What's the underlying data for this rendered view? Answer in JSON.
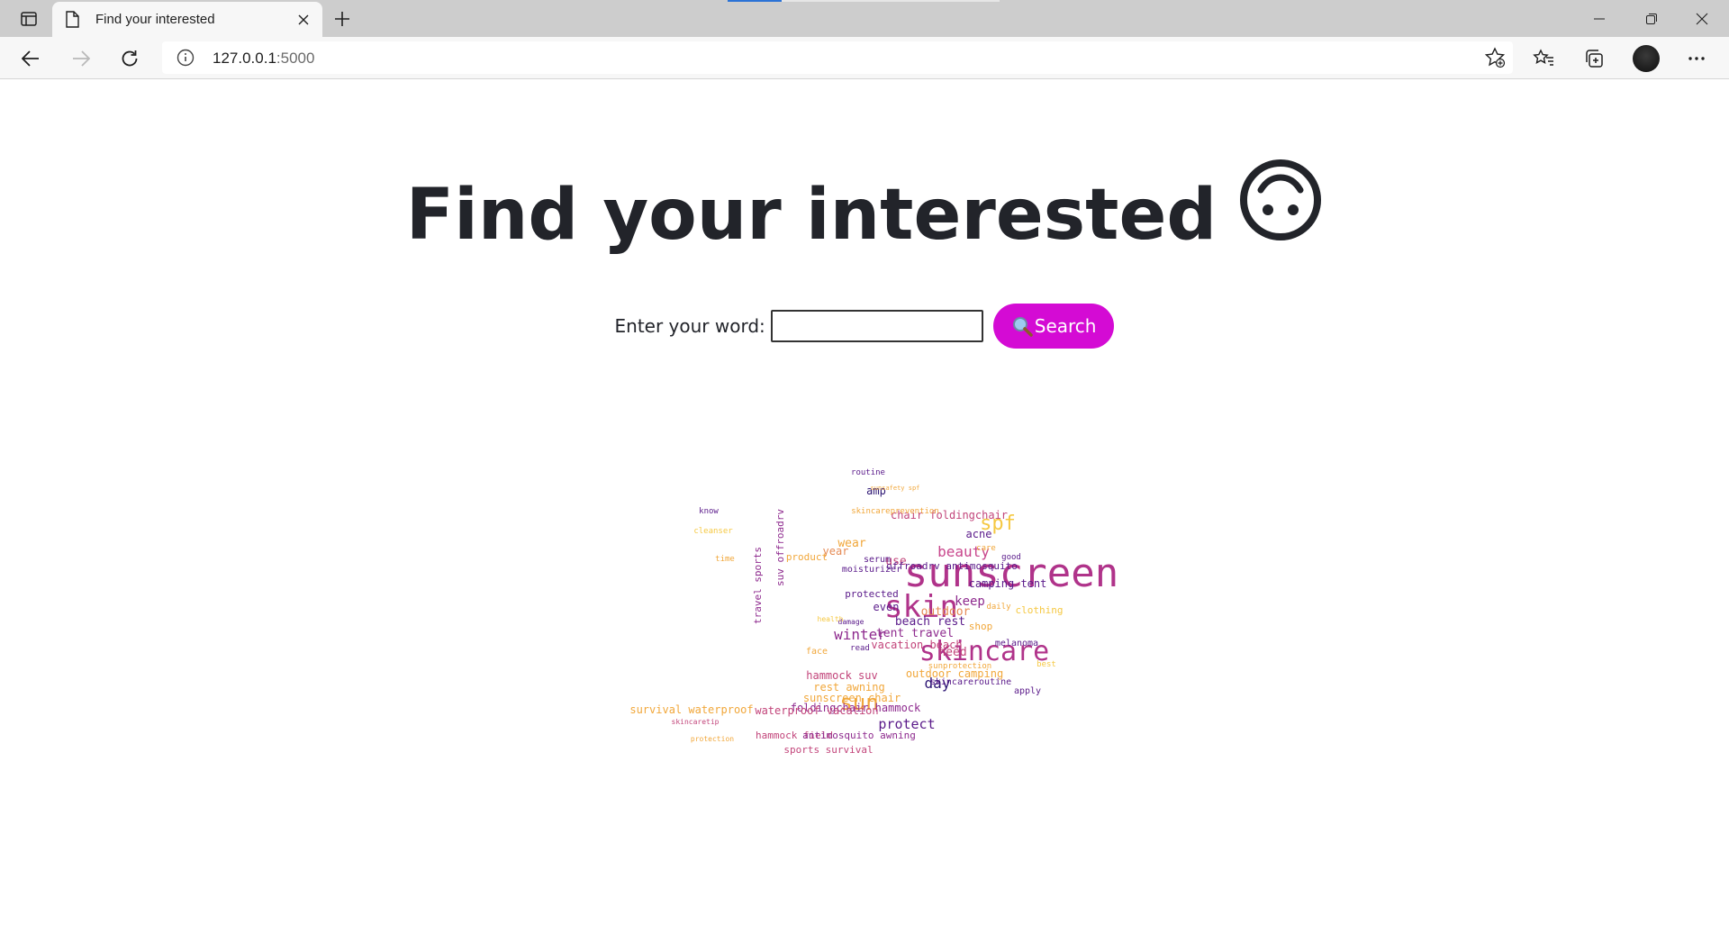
{
  "browser": {
    "tab_title": "Find your interested",
    "url_host": "127.0.0.1",
    "url_port": ":5000"
  },
  "page": {
    "title": "Find your interested",
    "title_emoji": "upside-down-face-icon",
    "search_label": "Enter your word:",
    "search_value": "",
    "search_button": "Search",
    "search_button_icon": "magnifier-icon",
    "accent_color": "#d40bd4"
  },
  "wordcloud": {
    "words": [
      {
        "text": "sunscreen",
        "color": "#b0338a"
      },
      {
        "text": "skincare",
        "color": "#b0338a"
      },
      {
        "text": "skin",
        "color": "#b0338a"
      },
      {
        "text": "sun",
        "color": "#f1a73a"
      },
      {
        "text": "spf",
        "color": "#f5c842"
      },
      {
        "text": "beauty",
        "color": "#c8468c"
      },
      {
        "text": "protect",
        "color": "#5a1a8a"
      },
      {
        "text": "day",
        "color": "#2b1473"
      },
      {
        "text": "winter",
        "color": "#8e2a8e"
      },
      {
        "text": "keep",
        "color": "#8e2a8e"
      },
      {
        "text": "need",
        "color": "#c2447a"
      },
      {
        "text": "use",
        "color": "#c2447a"
      },
      {
        "text": "amp",
        "color": "#2b1473"
      },
      {
        "text": "acne",
        "color": "#5a1a8a"
      },
      {
        "text": "wear",
        "color": "#f1a73a"
      },
      {
        "text": "year",
        "color": "#e58a54"
      },
      {
        "text": "even",
        "color": "#5a1a8a"
      },
      {
        "text": "outdoor",
        "color": "#e58a54"
      },
      {
        "text": "protected",
        "color": "#5a1a8a"
      },
      {
        "text": "beach rest",
        "color": "#5a1a8a"
      },
      {
        "text": "tent travel",
        "color": "#8e2a8e"
      },
      {
        "text": "vacation beach",
        "color": "#c2447a"
      },
      {
        "text": "outdoor camping",
        "color": "#f1a73a"
      },
      {
        "text": "skincareroutine",
        "color": "#5a1a8a"
      },
      {
        "text": "hammock suv",
        "color": "#c2447a"
      },
      {
        "text": "rest awning",
        "color": "#f1a73a"
      },
      {
        "text": "sunscreen chair",
        "color": "#f1a73a"
      },
      {
        "text": "foldingchair hammock",
        "color": "#8e2a8e"
      },
      {
        "text": "survival waterproof",
        "color": "#f1a73a"
      },
      {
        "text": "waterproof vacation",
        "color": "#c2447a"
      },
      {
        "text": "hammock field",
        "color": "#c2447a"
      },
      {
        "text": "antimosquito awning",
        "color": "#8e2a8e"
      },
      {
        "text": "sports survival",
        "color": "#c2447a"
      },
      {
        "text": "chair foldingchair",
        "color": "#c2447a"
      },
      {
        "text": "camping tent",
        "color": "#5a1a8a"
      },
      {
        "text": "offroadrv antimosquito",
        "color": "#5a1a8a"
      },
      {
        "text": "moisturizer",
        "color": "#5a1a8a"
      },
      {
        "text": "product",
        "color": "#f1a73a"
      },
      {
        "text": "serum",
        "color": "#5a1a8a"
      },
      {
        "text": "clothing",
        "color": "#f5c842"
      },
      {
        "text": "shop",
        "color": "#f1a73a"
      },
      {
        "text": "melanoma",
        "color": "#5a1a8a"
      },
      {
        "text": "face",
        "color": "#f1a73a"
      },
      {
        "text": "apply",
        "color": "#5a1a8a"
      },
      {
        "text": "routine",
        "color": "#5a1a8a"
      },
      {
        "text": "suv offroadrv",
        "color": "#8e2a8e"
      },
      {
        "text": "travel sports",
        "color": "#8e2a8e"
      },
      {
        "text": "skincareprevention",
        "color": "#f1a73a"
      },
      {
        "text": "know",
        "color": "#5a1a8a"
      },
      {
        "text": "cleanser",
        "color": "#f5c842"
      },
      {
        "text": "time",
        "color": "#f1a73a"
      },
      {
        "text": "read",
        "color": "#5a1a8a"
      },
      {
        "text": "damage",
        "color": "#5a1a8a"
      },
      {
        "text": "health",
        "color": "#f5c842"
      },
      {
        "text": "care",
        "color": "#f1a73a"
      },
      {
        "text": "good",
        "color": "#5a1a8a"
      },
      {
        "text": "best",
        "color": "#f5c842"
      },
      {
        "text": "daily",
        "color": "#f1a73a"
      },
      {
        "text": "sunsafety spf",
        "color": "#f1a73a"
      },
      {
        "text": "sunprotection",
        "color": "#f1a73a"
      },
      {
        "text": "skincaretip",
        "color": "#c2447a"
      },
      {
        "text": "protection",
        "color": "#f1a73a"
      }
    ]
  }
}
